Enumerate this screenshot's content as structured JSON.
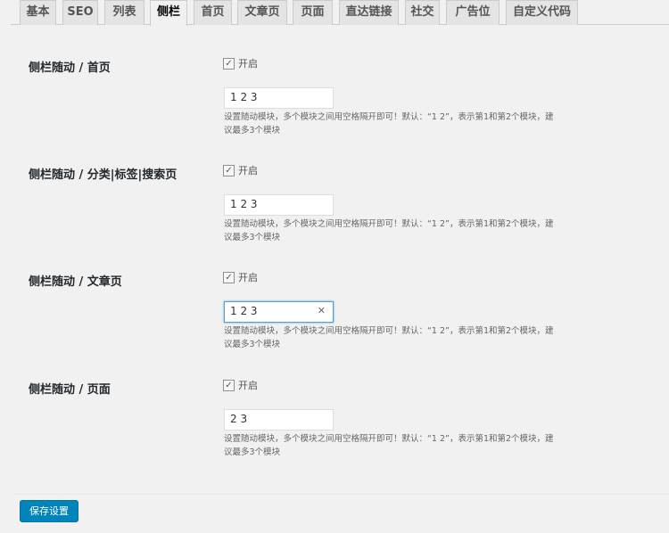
{
  "tabs": [
    "基本",
    "SEO",
    "列表",
    "侧栏",
    "首页",
    "文章页",
    "页面",
    "直达链接",
    "社交",
    "广告位",
    "自定义代码"
  ],
  "active_tab": "侧栏",
  "sections": [
    {
      "title": "侧栏随动 / 首页",
      "checkbox_label": "开启",
      "checked": true,
      "value": "1 2 3",
      "desc": "设置随动模块，多个模块之间用空格隔开即可！默认：“1 2”，表示第1和第2个模块，建议最多3个模块"
    },
    {
      "title": "侧栏随动 / 分类|标签|搜索页",
      "checkbox_label": "开启",
      "checked": true,
      "value": "1 2 3",
      "desc": "设置随动模块，多个模块之间用空格隔开即可！默认：“1 2”，表示第1和第2个模块，建议最多3个模块"
    },
    {
      "title": "侧栏随动 / 文章页",
      "checkbox_label": "开启",
      "checked": true,
      "value": "1 2 3",
      "desc": "设置随动模块，多个模块之间用空格隔开即可！默认：“1 2”，表示第1和第2个模块，建议最多3个模块"
    },
    {
      "title": "侧栏随动 / 页面",
      "checkbox_label": "开启",
      "checked": true,
      "value": "2 3",
      "desc": "设置随动模块，多个模块之间用空格隔开即可！默认：“1 2”，表示第1和第2个模块，建议最多3个模块"
    }
  ],
  "save_label": "保存设置"
}
